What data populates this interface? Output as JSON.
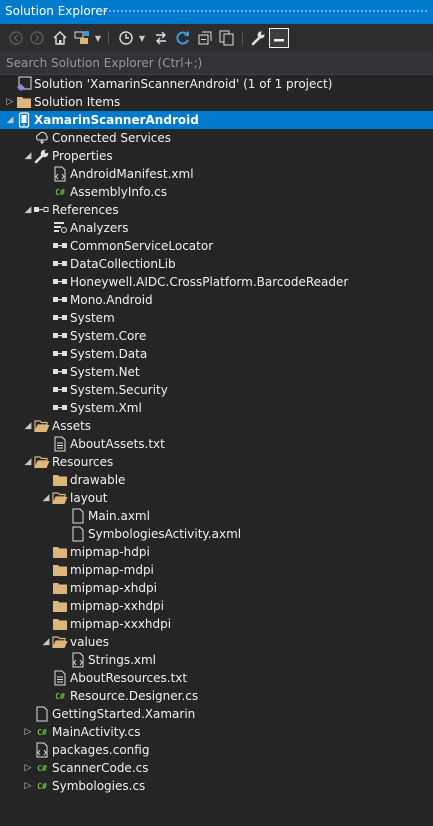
{
  "window": {
    "title": "Solution Explorer"
  },
  "search": {
    "placeholder": "Search Solution Explorer (Ctrl+;)"
  },
  "toolbar": {
    "icons": [
      "back-icon",
      "forward-icon",
      "home-icon",
      "switch-views-icon",
      "dropdown-icon",
      "pending-changes-icon",
      "dropdown-icon",
      "sync-icon",
      "refresh-icon",
      "collapse-all-icon",
      "show-all-files-icon",
      "properties-icon",
      "preview-icon"
    ]
  },
  "tree": [
    {
      "label": "Solution 'XamarinScannerAndroid' (1 of 1 project)",
      "icon": "solution-icon",
      "level": 0,
      "expander": "none"
    },
    {
      "label": "Solution Items",
      "icon": "folder-icon",
      "level": 0,
      "expander": "collapsed"
    },
    {
      "label": "XamarinScannerAndroid",
      "icon": "android-project-icon",
      "level": 0,
      "expander": "expanded",
      "selected": true
    },
    {
      "label": "Connected Services",
      "icon": "connected-services-icon",
      "level": 1,
      "expander": "none"
    },
    {
      "label": "Properties",
      "icon": "wrench-icon",
      "level": 1,
      "expander": "expanded"
    },
    {
      "label": "AndroidManifest.xml",
      "icon": "xml-file-icon",
      "level": 2,
      "expander": "none"
    },
    {
      "label": "AssemblyInfo.cs",
      "icon": "csharp-file-icon",
      "level": 2,
      "expander": "none"
    },
    {
      "label": "References",
      "icon": "references-icon",
      "level": 1,
      "expander": "expanded"
    },
    {
      "label": "Analyzers",
      "icon": "analyzers-icon",
      "level": 2,
      "expander": "none"
    },
    {
      "label": "CommonServiceLocator",
      "icon": "reference-icon",
      "level": 2,
      "expander": "none"
    },
    {
      "label": "DataCollectionLib",
      "icon": "reference-icon",
      "level": 2,
      "expander": "none"
    },
    {
      "label": "Honeywell.AIDC.CrossPlatform.BarcodeReader",
      "icon": "reference-icon",
      "level": 2,
      "expander": "none"
    },
    {
      "label": "Mono.Android",
      "icon": "reference-icon",
      "level": 2,
      "expander": "none"
    },
    {
      "label": "System",
      "icon": "reference-icon",
      "level": 2,
      "expander": "none"
    },
    {
      "label": "System.Core",
      "icon": "reference-icon",
      "level": 2,
      "expander": "none"
    },
    {
      "label": "System.Data",
      "icon": "reference-icon",
      "level": 2,
      "expander": "none"
    },
    {
      "label": "System.Net",
      "icon": "reference-icon",
      "level": 2,
      "expander": "none"
    },
    {
      "label": "System.Security",
      "icon": "reference-icon",
      "level": 2,
      "expander": "none"
    },
    {
      "label": "System.Xml",
      "icon": "reference-icon",
      "level": 2,
      "expander": "none"
    },
    {
      "label": "Assets",
      "icon": "folder-open-icon",
      "level": 1,
      "expander": "expanded"
    },
    {
      "label": "AboutAssets.txt",
      "icon": "text-file-icon",
      "level": 2,
      "expander": "none"
    },
    {
      "label": "Resources",
      "icon": "folder-open-icon",
      "level": 1,
      "expander": "expanded"
    },
    {
      "label": "drawable",
      "icon": "folder-icon",
      "level": 2,
      "expander": "none"
    },
    {
      "label": "layout",
      "icon": "folder-open-icon",
      "level": 2,
      "expander": "expanded"
    },
    {
      "label": "Main.axml",
      "icon": "file-icon",
      "level": 3,
      "expander": "none"
    },
    {
      "label": "SymbologiesActivity.axml",
      "icon": "file-icon",
      "level": 3,
      "expander": "none"
    },
    {
      "label": "mipmap-hdpi",
      "icon": "folder-icon",
      "level": 2,
      "expander": "none"
    },
    {
      "label": "mipmap-mdpi",
      "icon": "folder-icon",
      "level": 2,
      "expander": "none"
    },
    {
      "label": "mipmap-xhdpi",
      "icon": "folder-icon",
      "level": 2,
      "expander": "none"
    },
    {
      "label": "mipmap-xxhdpi",
      "icon": "folder-icon",
      "level": 2,
      "expander": "none"
    },
    {
      "label": "mipmap-xxxhdpi",
      "icon": "folder-icon",
      "level": 2,
      "expander": "none"
    },
    {
      "label": "values",
      "icon": "folder-open-icon",
      "level": 2,
      "expander": "expanded"
    },
    {
      "label": "Strings.xml",
      "icon": "xml-file-icon",
      "level": 3,
      "expander": "none"
    },
    {
      "label": "AboutResources.txt",
      "icon": "text-file-icon",
      "level": 2,
      "expander": "none"
    },
    {
      "label": "Resource.Designer.cs",
      "icon": "csharp-file-icon",
      "level": 2,
      "expander": "none"
    },
    {
      "label": "GettingStarted.Xamarin",
      "icon": "file-icon",
      "level": 1,
      "expander": "none"
    },
    {
      "label": "MainActivity.cs",
      "icon": "csharp-file-icon",
      "level": 1,
      "expander": "collapsed"
    },
    {
      "label": "packages.config",
      "icon": "xml-file-icon",
      "level": 1,
      "expander": "none"
    },
    {
      "label": "ScannerCode.cs",
      "icon": "csharp-file-icon",
      "level": 1,
      "expander": "collapsed"
    },
    {
      "label": "Symbologies.cs",
      "icon": "csharp-file-icon",
      "level": 1,
      "expander": "collapsed"
    }
  ]
}
